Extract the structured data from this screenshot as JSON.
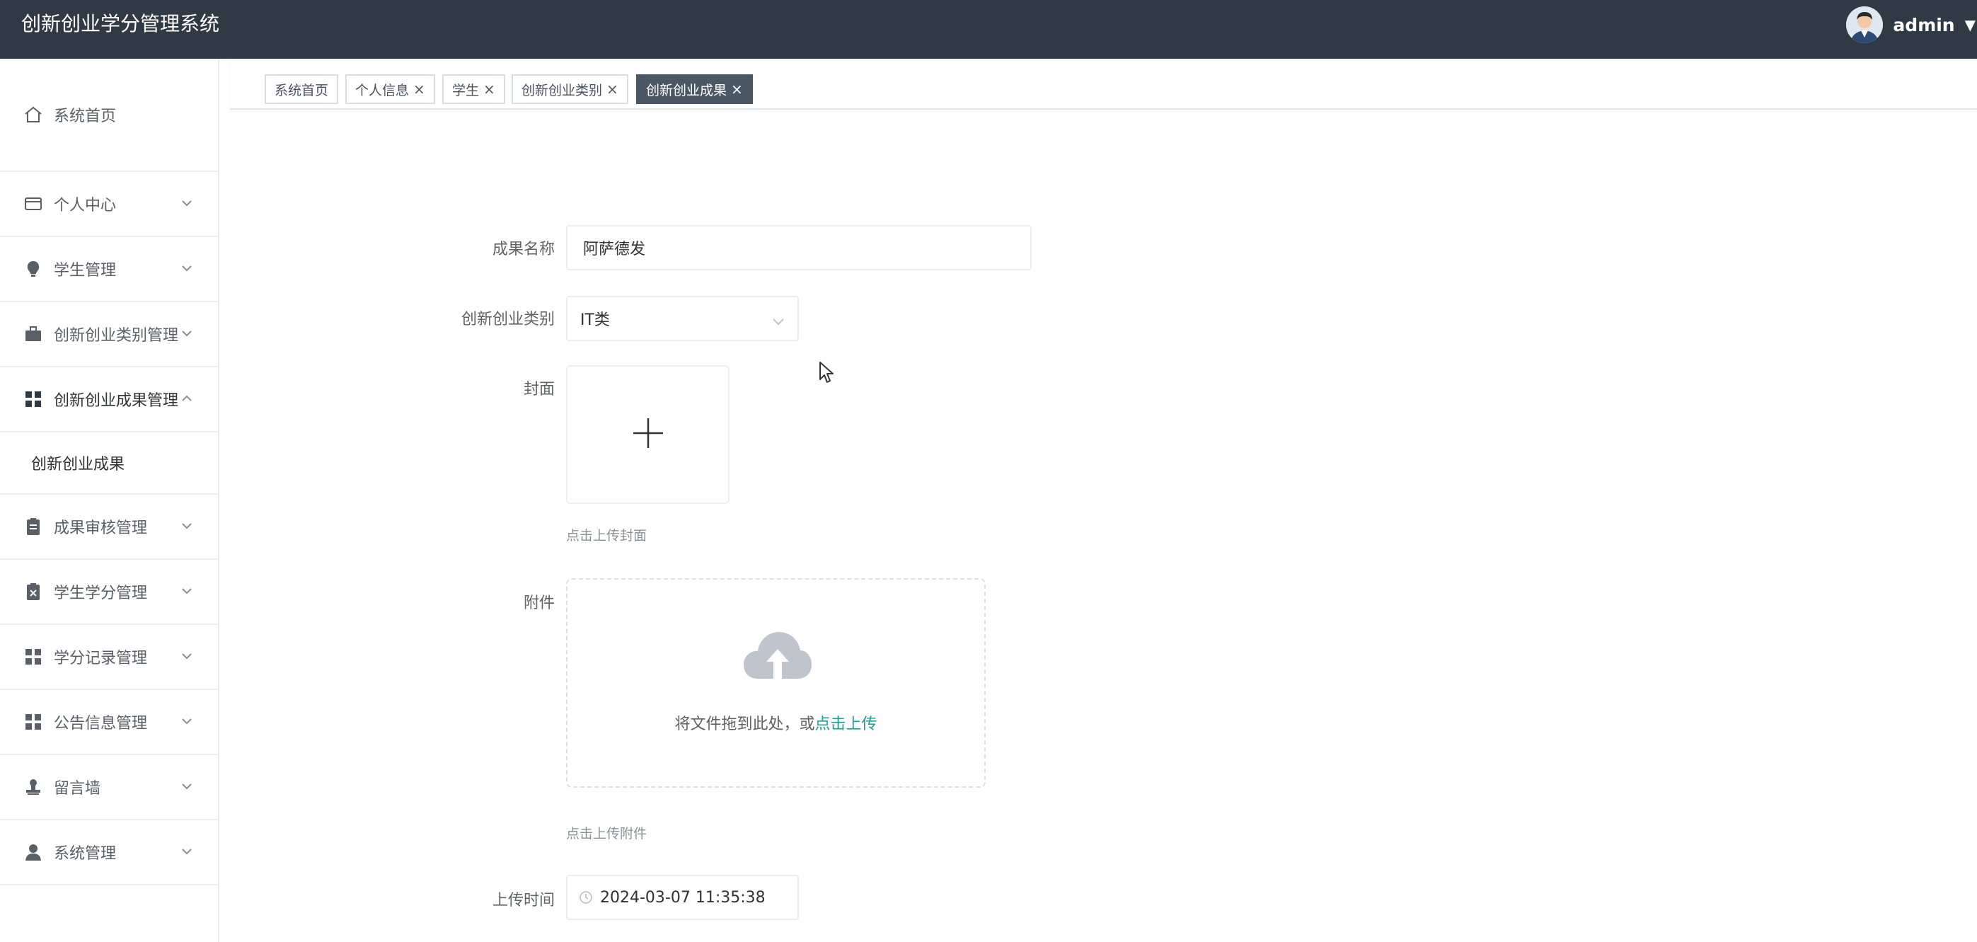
{
  "header": {
    "app_title": "创新创业学分管理系统",
    "user_name": "admin",
    "icons": {
      "avatar": "user-avatar",
      "caret": "caret-down-icon"
    }
  },
  "sidebar": {
    "items": [
      {
        "label": "系统首页",
        "icon": "home-icon"
      },
      {
        "label": "个人中心",
        "icon": "card-icon"
      },
      {
        "label": "学生管理",
        "icon": "bulb-icon"
      },
      {
        "label": "创新创业类别管理",
        "icon": "briefcase-icon"
      },
      {
        "label": "创新创业成果管理",
        "icon": "grid-icon"
      },
      {
        "label": "成果审核管理",
        "icon": "clipboard-icon"
      },
      {
        "label": "学生学分管理",
        "icon": "clipboard-x-icon"
      },
      {
        "label": "学分记录管理",
        "icon": "grid-icon"
      },
      {
        "label": "公告信息管理",
        "icon": "grid-icon"
      },
      {
        "label": "留言墙",
        "icon": "stamp-icon"
      },
      {
        "label": "系统管理",
        "icon": "user-icon"
      }
    ],
    "sub_item": "创新创业成果"
  },
  "tabs": [
    {
      "label": "系统首页",
      "closable": false
    },
    {
      "label": "个人信息",
      "closable": true
    },
    {
      "label": "学生",
      "closable": true
    },
    {
      "label": "创新创业类别",
      "closable": true
    },
    {
      "label": "创新创业成果",
      "closable": true,
      "active": true
    }
  ],
  "form": {
    "name_label": "成果名称",
    "name_value": "阿萨德发",
    "category_label": "创新创业类别",
    "category_value": "IT类",
    "cover_label": "封面",
    "cover_hint": "点击上传封面",
    "attachment_label": "附件",
    "dragger_text": "将文件拖到此处，或",
    "dragger_link": "点击上传",
    "attachment_hint": "点击上传附件",
    "time_label": "上传时间",
    "time_value": "2024-03-07 11:35:38"
  },
  "colors": {
    "header_bg": "#2f3a45",
    "active_tab_bg": "#4b5764",
    "link": "#1aa094"
  }
}
